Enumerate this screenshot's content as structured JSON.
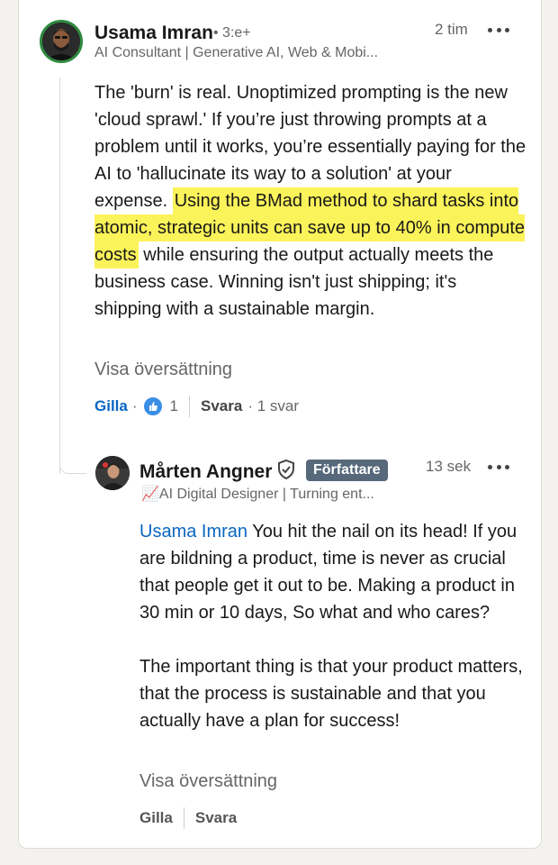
{
  "comment": {
    "author": "Usama Imran",
    "degree": "• 3:e+",
    "headline": "AI Consultant | Generative AI, Web & Mobi...",
    "time": "2 tim",
    "text_before": "The 'burn' is real. Unoptimized prompting is the new 'cloud sprawl.' If you’re just throwing prompts at a problem until it works, you’re essentially paying for the AI to 'hallucinate its way to a solution' at your expense. ",
    "text_highlight": "Using the BMad method to shard tasks into atomic, strategic units can save up to 40% in compute costs",
    "text_after": " while ensuring the output actually meets the business case. Winning isn't just shipping; it's shipping with a sustainable margin.",
    "translate": "Visa översättning",
    "like_label": "Gilla",
    "dot": "·",
    "reaction_count": "1",
    "reply_label": "Svara",
    "reply_count": "· 1 svar"
  },
  "reply": {
    "author": "Mårten Angner",
    "badge": "Författare",
    "headline": "📈AI Digital Designer | Turning ent...",
    "time": "13 sek",
    "mention": "Usama Imran",
    "text_p1": " You hit the nail on its head! If you are bildning a product, time is never as crucial that people get it out to be. Making a product in 30 min or 10 days, So what and who cares?",
    "text_p2": "The important thing is that your product matters, that the process is sustainable and that you actually have a plan for success!",
    "translate": "Visa översättning",
    "like_label": "Gilla",
    "reply_label": "Svara"
  },
  "colors": {
    "accent": "#0a66c2",
    "highlight": "#fbf35a",
    "badge": "#56687a",
    "ring": "#2f8a3f"
  },
  "icons": [
    "more-options-icon",
    "like-reaction-icon",
    "verified-shield-icon"
  ]
}
